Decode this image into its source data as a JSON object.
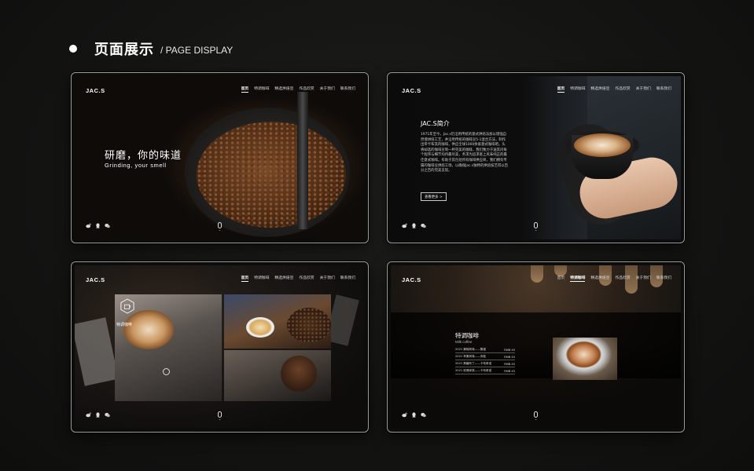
{
  "header": {
    "title": "页面展示",
    "subtitle": "/ PAGE DISPLAY"
  },
  "site": {
    "logo": "JAC.S"
  },
  "nav": [
    "首页",
    "特调咖啡",
    "精选烘焙豆",
    "作品欣赏",
    "关于我们",
    "联系我们"
  ],
  "frames": [
    {
      "name": "home",
      "active_nav": 0,
      "hero_cn": "研磨，你的味道",
      "hero_en": "Grinding, your smell"
    },
    {
      "name": "intro",
      "active_nav": 0,
      "intro_title": "JAC.S简介",
      "intro_text": "1971年至今，Jac.s仍沿用传统的意式烘焙法加以增强自然增烘焙工艺，并沿用传统的咖啡豆5-1混合方法，制作出带卡布其的咖啡，供应全球1000余家意式咖啡吧。头将却选的咖啡豆制一杯完美的咖啡，我们致力于送其问每个程序与细节均待最尽美，务求为追求者上风味纯正的最佳意式咖啡。有助于其包括所有咖啡供应商，我们拥有专属的咖啡豆烘焙工场，以确保Jac.s独特的烘焙技艺得以百分之百的完美呈现。",
      "more_button": "查看更多 >"
    },
    {
      "name": "products",
      "active_nav": 0,
      "featured_label": "特调咖啡"
    },
    {
      "name": "special",
      "active_nav": 1,
      "band_title": "特调咖啡",
      "band_subtitle": "Milk coffee",
      "menu": [
        {
          "item": "2021 蜂拥风味——醇香",
          "price": "RMB 45"
        },
        {
          "item": "2021 苹果风味——肉桂",
          "price": "RMB 45"
        },
        {
          "item": "2021 焦糖布丁——卡布奇诺",
          "price": "RMB 45"
        },
        {
          "item": "2021 玫瑰拿铁——卡布奇诺",
          "price": "RMB 45"
        }
      ]
    }
  ],
  "icons": {
    "social": [
      "weibo-icon",
      "qq-icon",
      "wechat-icon"
    ],
    "scroll": "mouse-scroll-icon"
  }
}
